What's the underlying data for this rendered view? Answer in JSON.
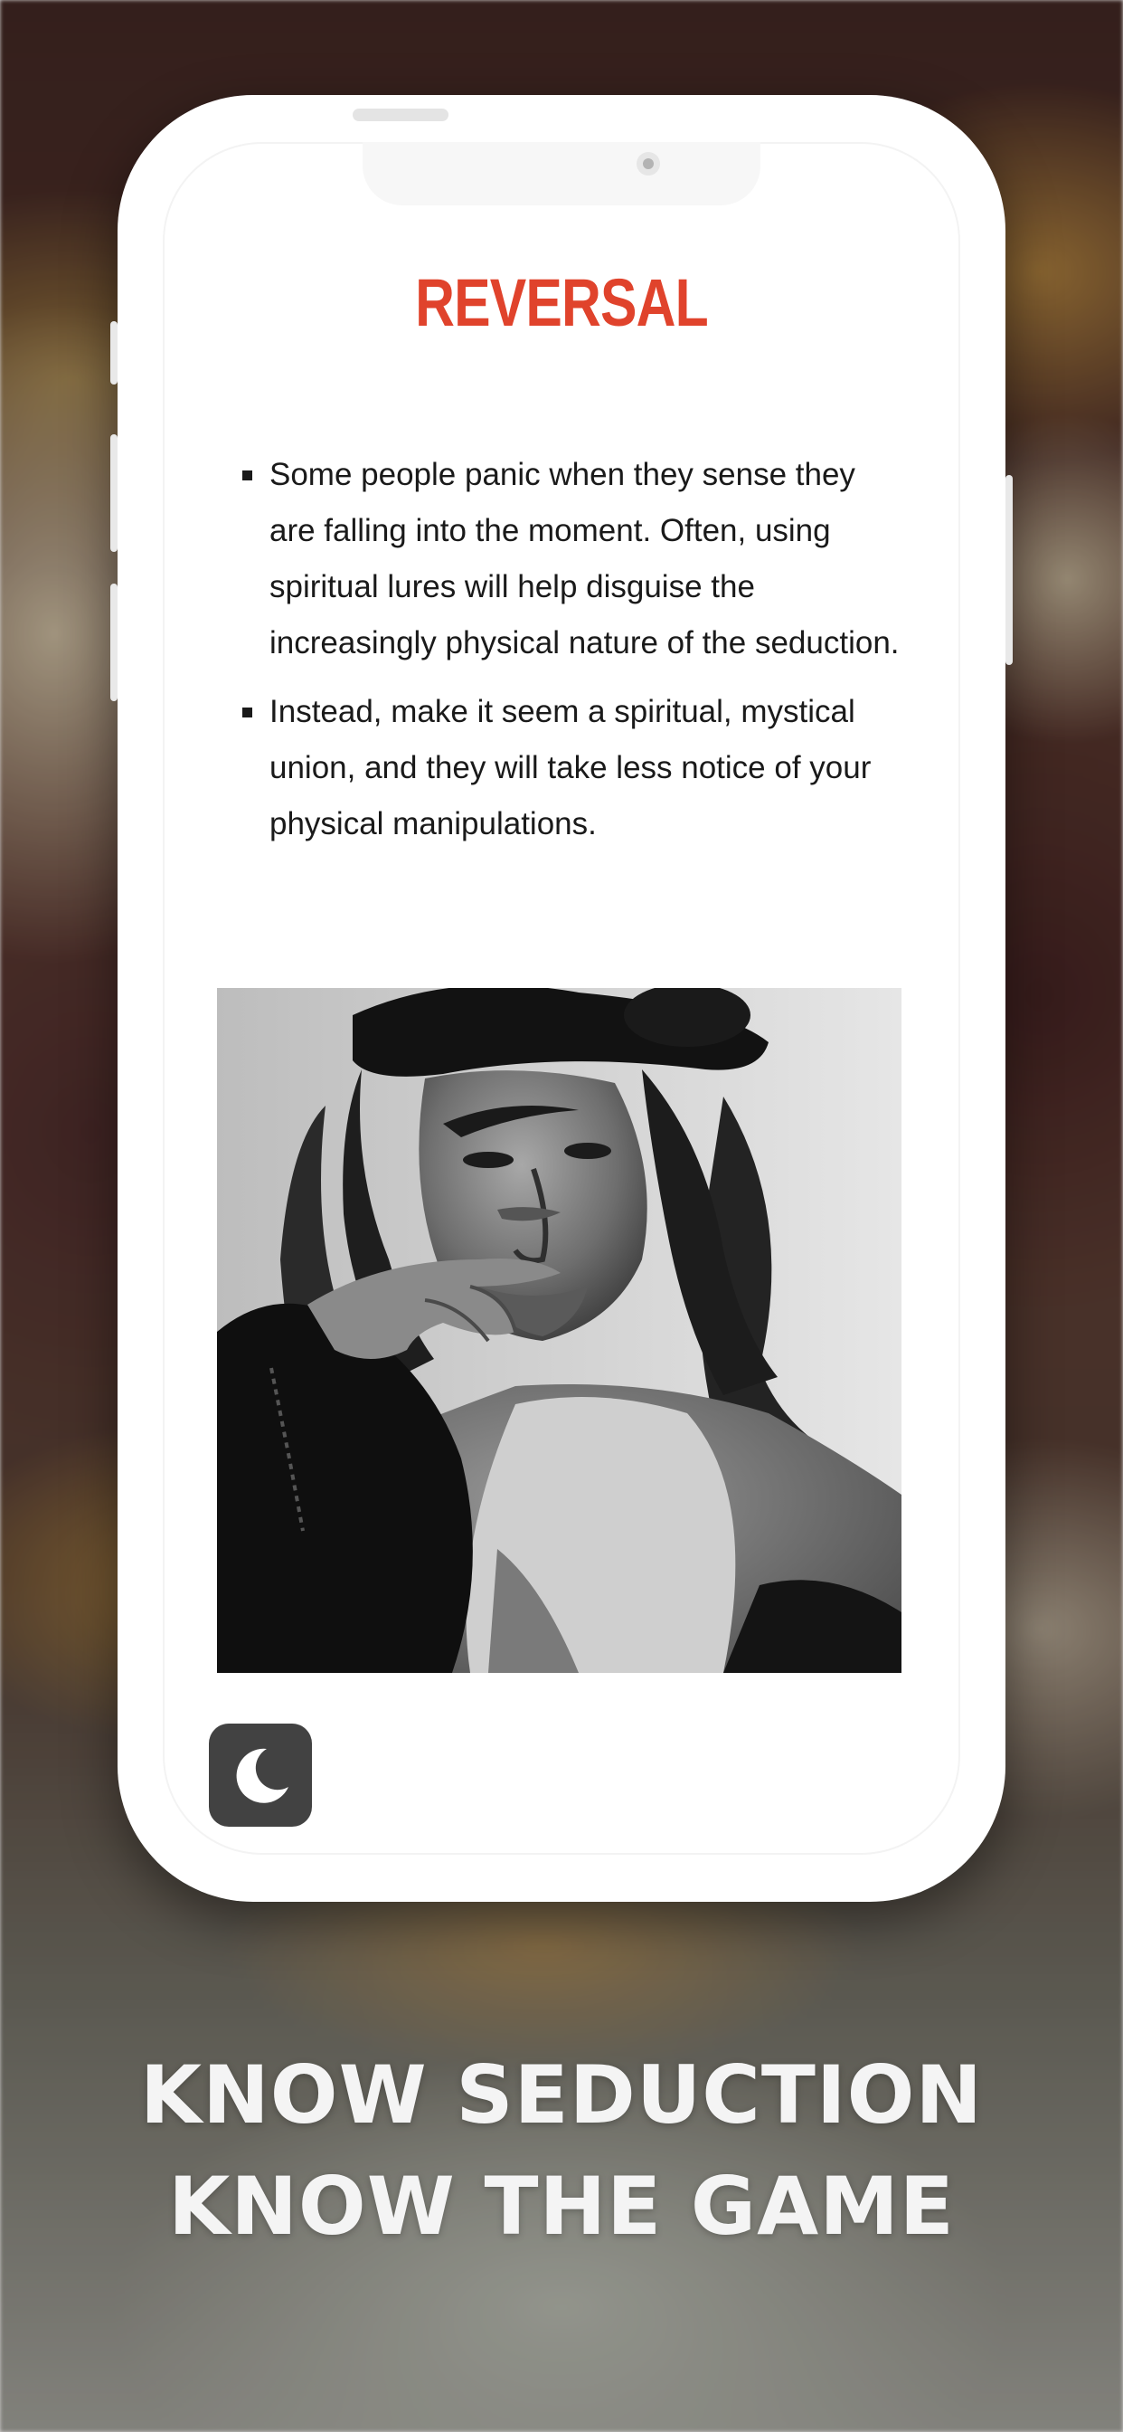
{
  "screen": {
    "title": "REVERSAL",
    "bullets": [
      "Some people panic when they sense they are falling into the moment. Often, using spiritual lures will help disguise the increasingly physical nature of the seduction.",
      "Instead, make it seem a spiritual, mystical union, and they will take less notice of your physical manipulations."
    ],
    "image": "black-and-white portrait photo",
    "dark_mode_icon": "moon-icon"
  },
  "tagline": {
    "line1": "KNOW SEDUCTION",
    "line2": "KNOW THE GAME"
  },
  "colors": {
    "title": "#e0432c",
    "toggle_bg": "#424242",
    "tagline": "#f4f4f4"
  }
}
